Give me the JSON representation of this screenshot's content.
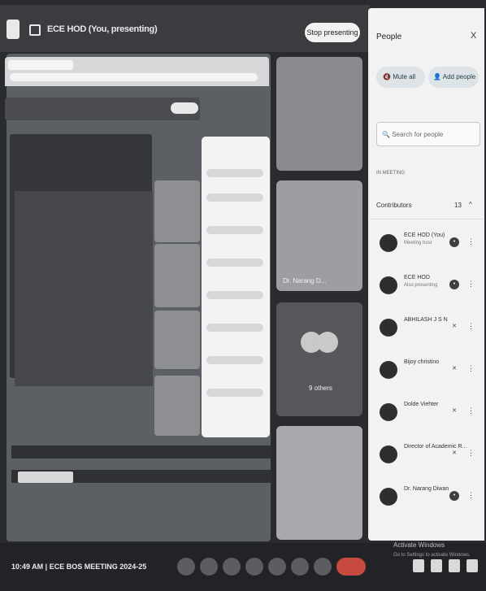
{
  "topbar": {
    "title": "ECE HOD (You, presenting)",
    "stop_label": "Stop presenting"
  },
  "stage": {
    "tile_name": "Dr. Narang D...",
    "others_label": "9 others"
  },
  "people_panel": {
    "title": "People",
    "close_icon": "close-icon",
    "mute_label": "Mute all",
    "add_label": "Add people",
    "search_placeholder": "Search for people",
    "section": "IN MEETING",
    "contributors_label": "Contributors",
    "contributors_count": "13",
    "participants": [
      {
        "name": "ECE HOD (You)",
        "role": "Meeting host"
      },
      {
        "name": "ECE HOD",
        "role": "Also presenting"
      },
      {
        "name": "ABHILASH J S N",
        "role": ""
      },
      {
        "name": "Bijoy christino",
        "role": ""
      },
      {
        "name": "Dolde Viehter",
        "role": ""
      },
      {
        "name": "Director of Academic R...",
        "role": ""
      },
      {
        "name": "Dr. Narang Diwan",
        "role": ""
      }
    ]
  },
  "bottombar": {
    "time_meeting": "10:49 AM  |  ECE BOS MEETING 2024-25"
  },
  "watermark": {
    "title": "Activate Windows",
    "sub": "Go to Settings to activate Windows."
  },
  "colors": {
    "end_call": "#c74a3e",
    "panel_bg": "#f2f2f3",
    "chip_bg": "#dde3e6"
  }
}
